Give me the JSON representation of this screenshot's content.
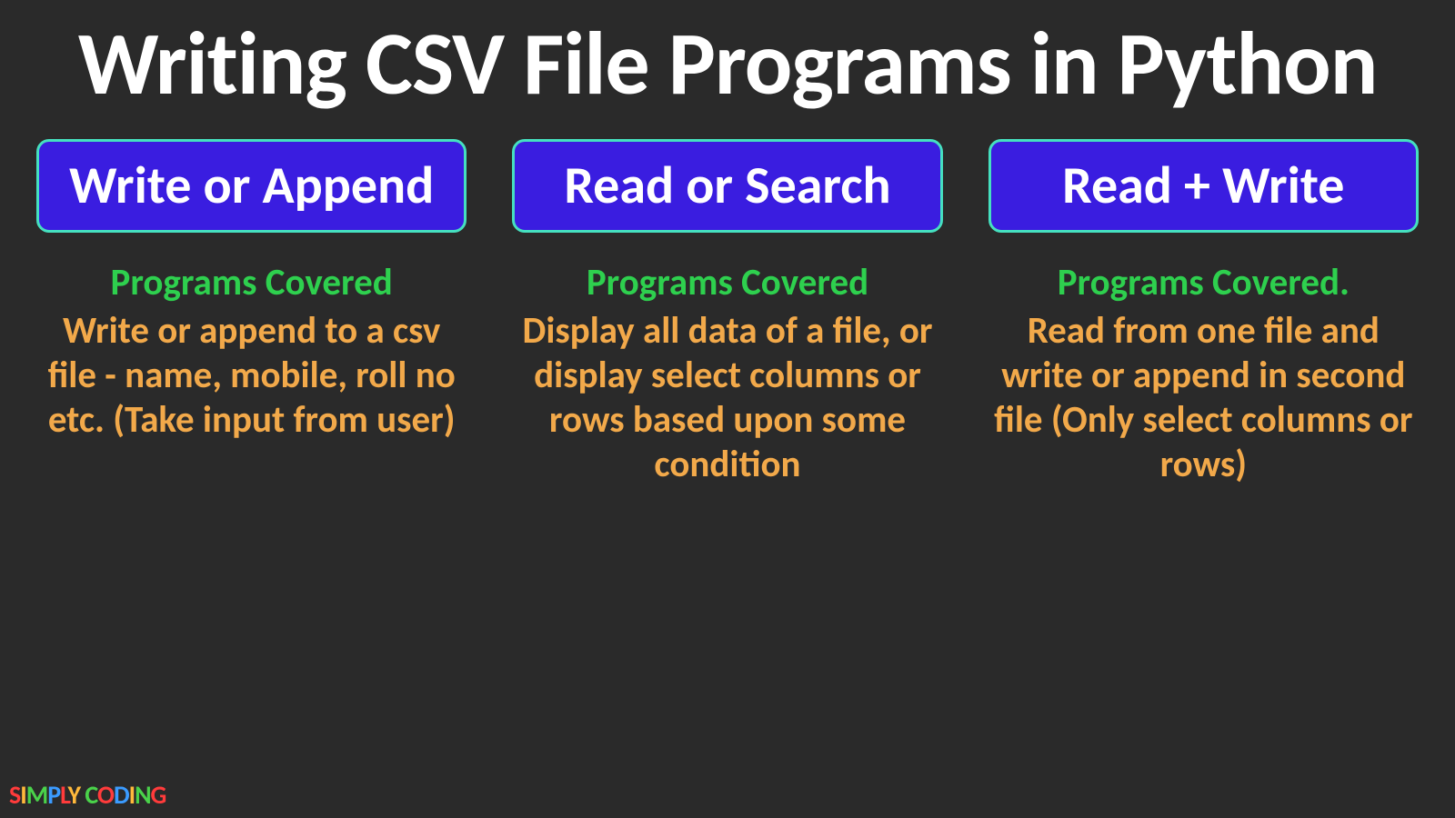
{
  "title": "Writing CSV File Programs in Python",
  "columns": [
    {
      "card_title": "Write or Append",
      "programs_label": "Programs Covered",
      "description": "Write or append to a csv file  - name, mobile, roll no etc. (Take input from user)"
    },
    {
      "card_title": "Read or Search",
      "programs_label": "Programs Covered",
      "description": "Display all data of a file, or display select columns or rows based upon some condition"
    },
    {
      "card_title": "Read + Write",
      "programs_label": "Programs Covered.",
      "description": "Read from one file and write or append in second file (Only select columns or rows)"
    }
  ],
  "logo_text": "SIMPLY CODING"
}
